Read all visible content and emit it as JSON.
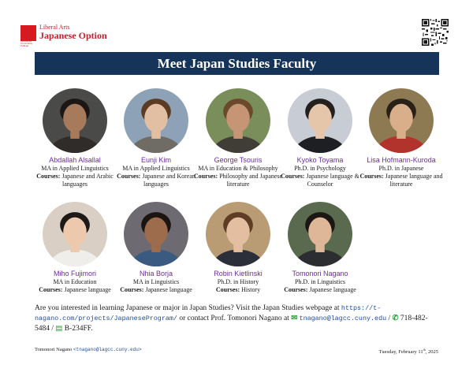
{
  "header": {
    "logo_small": "Liberal Arts",
    "logo_big": "Japanese Option",
    "logo_mark_caption": "LaGuardia Community College",
    "banner_title": "Meet Japan Studies Faculty"
  },
  "faculty": [
    {
      "name": "Abdallah Alsallal",
      "degree": "MA in Applied Linguistics",
      "courses_label": "Courses:",
      "courses": " Japanese and Arabic languages",
      "colors": {
        "bg": "#4a4a48",
        "skin": "#a87a5c",
        "hair": "#1c1714",
        "shirt": "#2f2c2a"
      }
    },
    {
      "name": "Eunji Kim",
      "degree": "MA in Applied Linguistics",
      "courses_label": "Courses:",
      "courses": " Japanese and Korean languages",
      "colors": {
        "bg": "#8da2b6",
        "skin": "#e2bfa2",
        "hair": "#5a3c25",
        "shirt": "#6f6c66"
      }
    },
    {
      "name": "George Tsouris",
      "degree": "MA in Education & Philosophy",
      "courses_label": "Courses:",
      "courses": " Philosophy and Japanese literature",
      "colors": {
        "bg": "#7a8e5c",
        "skin": "#c59575",
        "hair": "#6b4a2c",
        "shirt": "#403d37"
      }
    },
    {
      "name": "Kyoko Toyama",
      "degree": "Ph.D. in Psychology",
      "courses_label": "Courses:",
      "courses": " Japanese language & Counselor",
      "colors": {
        "bg": "#c8ccd4",
        "skin": "#e6c6aa",
        "hair": "#24201d",
        "shirt": "#1e1f22"
      }
    },
    {
      "name": "Lisa Hofmann-Kuroda",
      "degree": "Ph.D. in Japanese",
      "courses_label": "Courses:",
      "courses": " Japanese language and literature",
      "colors": {
        "bg": "#8e7a52",
        "skin": "#d9ae8a",
        "hair": "#2a2018",
        "shirt": "#b2322c"
      }
    },
    {
      "name": "Miho Fujimori",
      "degree": "MA in Education",
      "courses_label": "Courses:",
      "courses": " Japanese language",
      "colors": {
        "bg": "#d9cfc4",
        "skin": "#ecc9ac",
        "hair": "#1d1916",
        "shirt": "#efeeea"
      }
    },
    {
      "name": "Nhia Borja",
      "degree": "MA in Linguistics",
      "courses_label": "Courses:",
      "courses": " Japanese language",
      "colors": {
        "bg": "#6d6a72",
        "skin": "#9c6c4c",
        "hair": "#1b1512",
        "shirt": "#3a5a82"
      }
    },
    {
      "name": "Robin Kietlinski",
      "degree": "Ph.D. in History",
      "courses_label": "Courses:",
      "courses": " History",
      "colors": {
        "bg": "#b99c74",
        "skin": "#e4bea0",
        "hair": "#5e3d24",
        "shirt": "#2b2f3a"
      }
    },
    {
      "name": "Tomonori Nagano",
      "degree": "Ph.D. in Linguistics",
      "courses_label": "Courses:",
      "courses": " Japanese language",
      "colors": {
        "bg": "#5a6a4e",
        "skin": "#ddb798",
        "hair": "#1a1714",
        "shirt": "#2c2d30"
      }
    }
  ],
  "footer_paragraph": {
    "text1": "Are you interested in learning Japanese or major in Japan Studies?  Visit the Japan Studies webpage at ",
    "url": "https://t-nagano.com/projects/JapaneseProgram/",
    "text2": " or contact Prof. Tomonori Nagano at ",
    "email": "tnagano@lagcc.cuny.edu",
    "sep1": " / ",
    "phone": "718-482-5484",
    "sep2": " / ",
    "room": "B-234FF."
  },
  "footer": {
    "author": "Tomonori Nagano ",
    "author_email": "<tnagano@lagcc.cuny.edu>",
    "date_prefix": "Tuesday, February 11",
    "date_sup": "th",
    "date_suffix": ", 2025"
  }
}
